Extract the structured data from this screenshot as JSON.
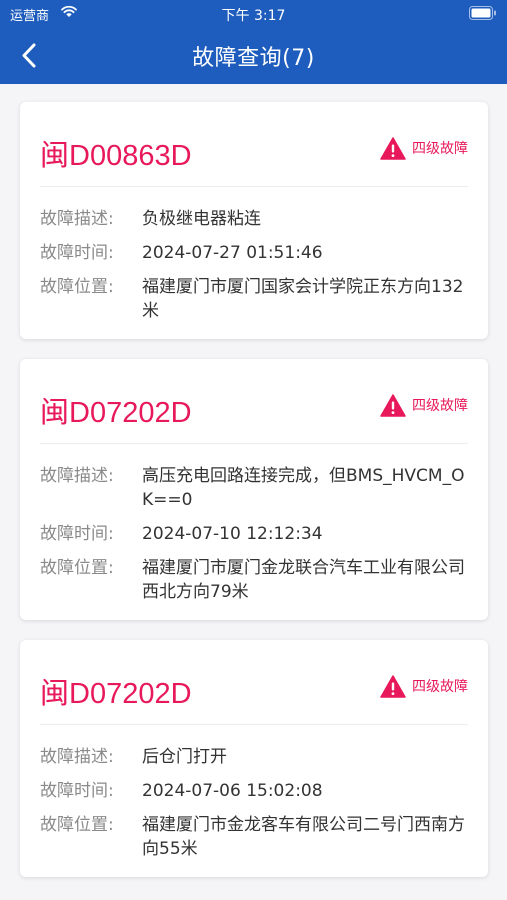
{
  "status_bar": {
    "carrier": "运营商",
    "time": "下午 3:17"
  },
  "nav": {
    "title": "故障查询(7)"
  },
  "field_labels": {
    "desc": "故障描述:",
    "time": "故障时间:",
    "location": "故障位置:"
  },
  "colors": {
    "header": "#1e5dbd",
    "accent": "#e8195a"
  },
  "faults": [
    {
      "plate": "闽D00863D",
      "level": "四级故障",
      "desc": "负极继电器粘连",
      "time": "2024-07-27 01:51:46",
      "location": "福建厦门市厦门国家会计学院正东方向132米"
    },
    {
      "plate": "闽D07202D",
      "level": "四级故障",
      "desc": "高压充电回路连接完成，但BMS_HVCM_OK==0",
      "time": "2024-07-10 12:12:34",
      "location": "福建厦门市厦门金龙联合汽车工业有限公司西北方向79米"
    },
    {
      "plate": "闽D07202D",
      "level": "四级故障",
      "desc": "后仓门打开",
      "time": "2024-07-06 15:02:08",
      "location": "福建厦门市金龙客车有限公司二号门西南方向55米"
    }
  ]
}
